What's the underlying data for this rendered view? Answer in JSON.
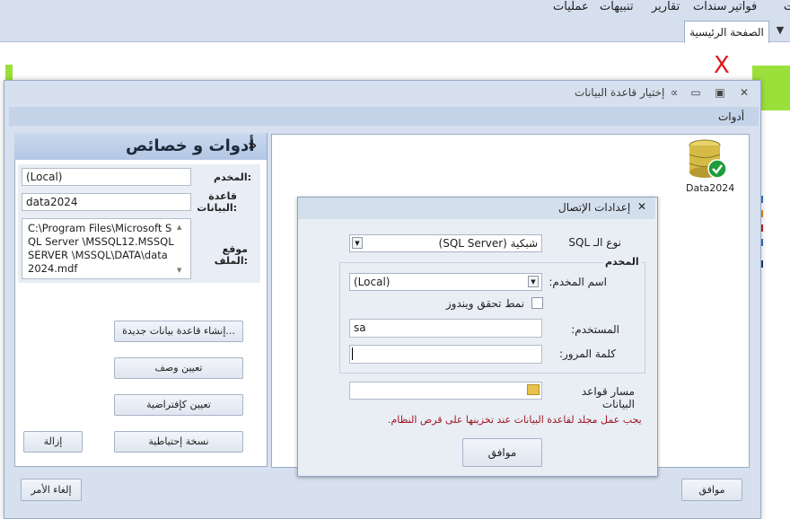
{
  "menu": {
    "items": [
      "ت",
      "فواتير",
      "سندات",
      "تقارير",
      "تنبيهات",
      "عمليات"
    ],
    "home_tab": "الصفحة الرئيسية"
  },
  "background": {
    "close_mark": "X"
  },
  "dialog": {
    "title": "إختيار قاعدة البيانات",
    "toolbar_label": "أدوات",
    "ok_button": "موافق",
    "cancel_button": "إلغاء الأمر"
  },
  "tools_panel": {
    "title": "أدوات و خصائص",
    "collapse_glyph": "»",
    "server_label": "المخدم:",
    "server_value": "(Local)",
    "database_label": "قاعدة البيانات:",
    "database_value": "data2024",
    "file_location_label": "موقع الملف:",
    "file_location_value": "C:\\Program Files\\Microsoft SQL Server \\MSSQL12.MSSQLSERVER \\MSSQL\\DATA\\data2024.mdf",
    "buttons": {
      "create_db": "إنشاء قاعدة بيانات جديدة...",
      "set_description": "تعيين وصف",
      "set_default": "تعيين كإفتراضية",
      "backup": "نسخة إحتياطية",
      "remove": "إزالة"
    }
  },
  "database_list": [
    {
      "name": "Data2024",
      "icon": "database-check-icon"
    }
  ],
  "connection_settings": {
    "title": "إعدادات الإتصال",
    "sql_type_label": "نوع الـ SQL",
    "sql_type_value": "(SQL Server) شبكية",
    "server_group_label": "المخدم",
    "server_name_label": "اسم المخدم:",
    "server_name_value": "(Local)",
    "windows_auth_label": "نمط تحقق ويندوز",
    "windows_auth_checked": false,
    "user_label": "المستخدم:",
    "user_value": "sa",
    "password_label": "كلمة المرور:",
    "password_value": "",
    "db_path_label": "مسار قواعد البيانات",
    "db_path_value": "",
    "warning": "يجب عمل مجلد لقاعدة البيانات عند تخزينها على قرص النظام.",
    "ok_button": "موافق"
  },
  "colors": {
    "accent_green": "#9be03a",
    "warning_red": "#a0141e",
    "close_red": "#e0161b",
    "check_green": "#1f9d3a"
  }
}
